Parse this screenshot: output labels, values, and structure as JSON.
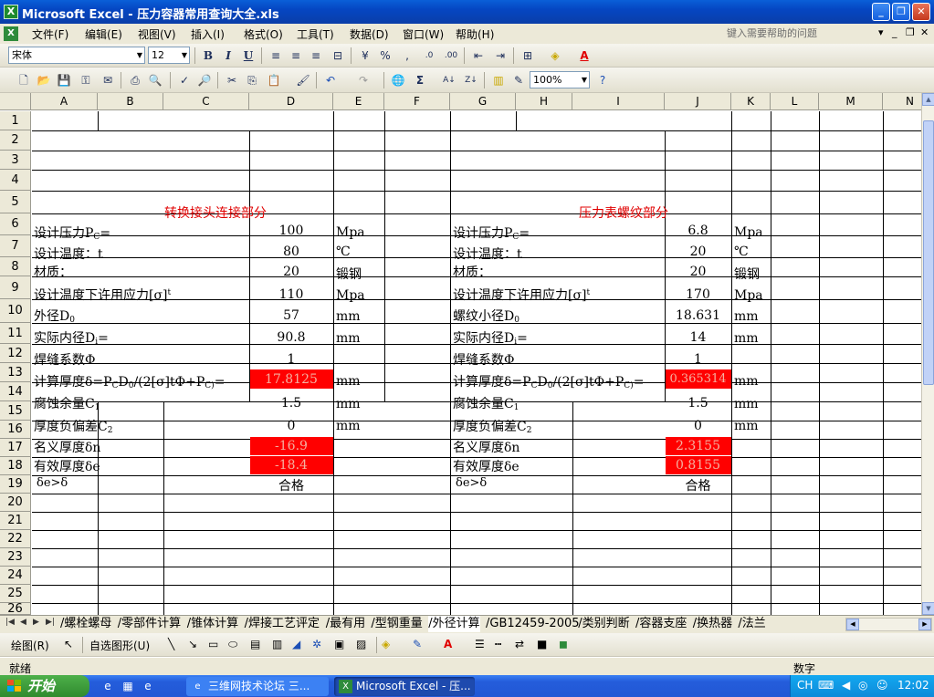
{
  "window": {
    "title": "Microsoft Excel - 压力容器常用查询大全.xls",
    "minimize": "_",
    "restore": "❐",
    "close": "✕"
  },
  "menu": {
    "items": [
      "文件(F)",
      "编辑(E)",
      "视图(V)",
      "插入(I)",
      "格式(O)",
      "工具(T)",
      "数据(D)",
      "窗口(W)",
      "帮助(H)"
    ],
    "help_placeholder": "键入需要帮助的问题",
    "mdi_min": "_",
    "mdi_restore": "❐",
    "mdi_close": "✕"
  },
  "format_toolbar": {
    "font": "宋体",
    "size": "12",
    "bold": "B",
    "italic": "I",
    "underline": "U",
    "percent": "%",
    "comma": ",",
    "font_color": "A"
  },
  "standard_toolbar": {
    "zoom": "100%",
    "sum": "Σ"
  },
  "columns": [
    "A",
    "B",
    "C",
    "D",
    "E",
    "F",
    "G",
    "H",
    "I",
    "J",
    "K",
    "L",
    "M",
    "N"
  ],
  "rows": [
    "1",
    "2",
    "3",
    "4",
    "5",
    "6",
    "7",
    "8",
    "9",
    "10",
    "11",
    "12",
    "13",
    "14",
    "15",
    "16",
    "17",
    "18",
    "19",
    "20",
    "21",
    "22",
    "23",
    "24",
    "25",
    "26"
  ],
  "left_table": {
    "header": "转换接头连接部分",
    "labels": {
      "r2": "设计压力P",
      "r2_sub": "C",
      "r2_tail": "=",
      "r3": "设计温度：t",
      "r4": "材质：",
      "r5": "设计温度下许用应力[σ]",
      "r5_sup": "t",
      "r6": "外径D",
      "r6_sub": "0",
      "r7": "实际内径D",
      "r7_sub": "i",
      "r7_tail": "=",
      "r8": "焊缝系数Φ",
      "r9_a": "计算厚度δ=P",
      "r9_sub1": "C",
      "r9_b": "D",
      "r9_sub2": "0",
      "r9_c": "/(2[σ]tΦ+P",
      "r9_sub3": "C)",
      "r9_d": "=",
      "r10": "腐蚀余量C",
      "r10_sub": "1",
      "r11": "厚度负偏差C",
      "r11_sub": "2",
      "r12": "名义厚度δn",
      "r13": "有效厚度δe",
      "r14": "δe>δ"
    },
    "values": {
      "r2": "100",
      "r3": "80",
      "r4": "20",
      "r5": "110",
      "r6": "57",
      "r7": "90.8",
      "r8": "1",
      "r9": "17.8125",
      "r10": "1.5",
      "r11": "0",
      "r12": "-16.9",
      "r13": "-18.4",
      "r14": "合格"
    },
    "units": {
      "r2": "Mpa",
      "r3": "℃",
      "r4": "锻钢",
      "r5": "Mpa",
      "r6": "mm",
      "r7": "mm",
      "r9": "mm",
      "r10": "mm",
      "r11": "mm"
    }
  },
  "right_table": {
    "header": "压力表螺纹部分",
    "labels": {
      "r2": "设计压力P",
      "r2_sub": "C",
      "r2_tail": "=",
      "r3": "设计温度：t",
      "r4": "材质：",
      "r5": "设计温度下许用应力[σ]",
      "r5_sup": "t",
      "r6": "螺纹小径D",
      "r6_sub": "0",
      "r7": "实际内径D",
      "r7_sub": "i",
      "r7_tail": "=",
      "r8": "焊缝系数Φ",
      "r9_a": "计算厚度δ=P",
      "r9_sub1": "C",
      "r9_b": "D",
      "r9_sub2": "0",
      "r9_c": "/(2[σ]tΦ+P",
      "r9_sub3": "C)",
      "r9_d": "=",
      "r10": "腐蚀余量C",
      "r10_sub": "1",
      "r11": "厚度负偏差C",
      "r11_sub": "2",
      "r12": "名义厚度δn",
      "r13": "有效厚度δe",
      "r14": "δe>δ"
    },
    "values": {
      "r2": "6.8",
      "r3": "20",
      "r4": "20",
      "r5": "170",
      "r6": "18.631",
      "r7": "14",
      "r8": "1",
      "r9": "0.365314",
      "r10": "1.5",
      "r11": "0",
      "r12": "2.3155",
      "r13": "0.8155",
      "r14": "合格"
    },
    "units": {
      "r2": "Mpa",
      "r3": "℃",
      "r4": "锻钢",
      "r5": "Mpa",
      "r6": "mm",
      "r7": "mm",
      "r9": "mm",
      "r10": "mm",
      "r11": "mm"
    }
  },
  "sheet_tabs": [
    "螺栓螺母",
    "零部件计算",
    "锥体计算",
    "焊接工艺评定",
    "最有用",
    "型钢重量",
    "外径计算",
    "GB12459-2005",
    "类别判断",
    "容器支座",
    "换热器",
    "法兰"
  ],
  "active_tab": "外径计算",
  "draw_toolbar": {
    "draw": "绘图(R)",
    "autoshape": "自选图形(U)"
  },
  "status": {
    "left": "就绪",
    "right": "数字"
  },
  "taskbar": {
    "start": "开始",
    "buttons": [
      "三维网技术论坛 三...",
      "Microsoft Excel - 压..."
    ],
    "lang": "CH",
    "clock": "12:02"
  },
  "colors": {
    "highlight_red": "#FF0000",
    "header_red": "#E00000",
    "title_blue": "#0A46C2"
  }
}
